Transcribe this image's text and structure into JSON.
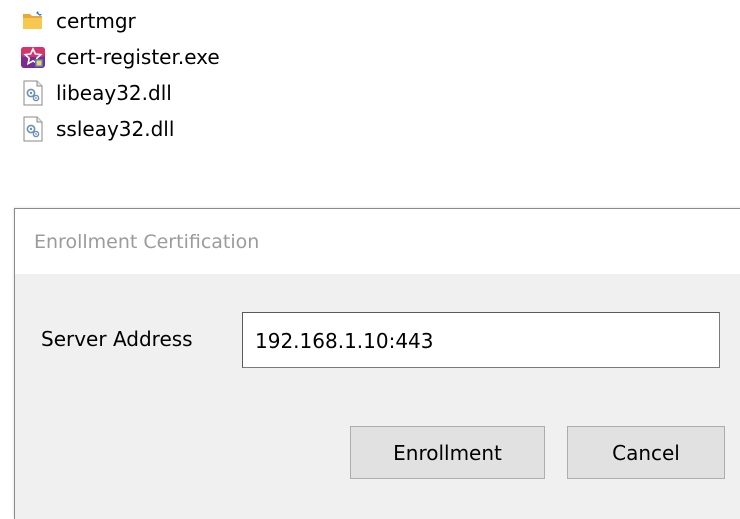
{
  "files": [
    {
      "name": "certmgr",
      "icon": "folder-icon"
    },
    {
      "name": "cert-register.exe",
      "icon": "app-exe-icon"
    },
    {
      "name": "libeay32.dll",
      "icon": "dll-file-icon"
    },
    {
      "name": "ssleay32.dll",
      "icon": "dll-file-icon"
    }
  ],
  "dialog": {
    "title": "Enrollment Certification",
    "server_label": "Server Address",
    "server_value": "192.168.1.10:443",
    "enroll_label": "Enrollment",
    "cancel_label": "Cancel"
  },
  "colors": {
    "dialog_bg": "#f0f0f0",
    "title_text": "#9b9b9b",
    "button_bg": "#e1e1e1",
    "folder": "#f6c34b",
    "exe_icon": "#d6336c"
  }
}
